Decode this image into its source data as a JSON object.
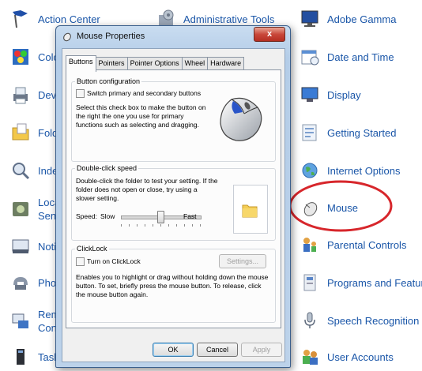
{
  "control_panel": {
    "items": [
      {
        "label": "Action Center",
        "icon": "flag-icon"
      },
      {
        "label": "Administrative Tools",
        "icon": "admin-tools-icon"
      },
      {
        "label": "Adobe Gamma",
        "icon": "monitor-icon"
      },
      {
        "label": "Colo",
        "icon": "color-icon"
      },
      {
        "label": "Date and Time",
        "icon": "calendar-icon"
      },
      {
        "label": "Devi",
        "icon": "printer-icon"
      },
      {
        "label": "Display",
        "icon": "display-icon"
      },
      {
        "label": "Fold",
        "icon": "folder-icon"
      },
      {
        "label": "Getting Started",
        "icon": "getting-started-icon"
      },
      {
        "label": "Inde",
        "icon": "indexing-icon"
      },
      {
        "label": "Internet Options",
        "icon": "globe-icon"
      },
      {
        "label": "Loca",
        "label2": "Sens",
        "icon": "sensor-icon"
      },
      {
        "label": "Mouse",
        "icon": "mouse-icon"
      },
      {
        "label": "Noti",
        "icon": "notification-icon"
      },
      {
        "label": "Parental Controls",
        "icon": "parental-controls-icon"
      },
      {
        "label": "Phon",
        "icon": "phone-icon"
      },
      {
        "label": "Programs and Features",
        "icon": "programs-icon"
      },
      {
        "label": "Rem",
        "label2": "Con",
        "icon": "remote-icon"
      },
      {
        "label": "Speech Recognition",
        "icon": "microphone-icon"
      },
      {
        "label": "Task",
        "icon": "taskbar-icon"
      },
      {
        "label": "User Accounts",
        "icon": "users-icon"
      }
    ],
    "highlight_color": "#d7262b"
  },
  "dialog": {
    "title": "Mouse Properties",
    "close_label": "x",
    "tabs": [
      "Buttons",
      "Pointers",
      "Pointer Options",
      "Wheel",
      "Hardware"
    ],
    "active_tab": "Buttons",
    "button_config": {
      "heading": "Button configuration",
      "checkbox_label": "Switch primary and secondary buttons",
      "description": "Select this check box to make the button on the right the one you use for primary functions such as selecting and dragging.",
      "checked": false
    },
    "double_click": {
      "heading": "Double-click speed",
      "description": "Double-click the folder to test your setting. If the folder does not open or close, try using a slower setting.",
      "speed_label": "Speed:",
      "slow_label": "Slow",
      "fast_label": "Fast",
      "speed_value": 0.5
    },
    "clicklock": {
      "heading": "ClickLock",
      "checkbox_label": "Turn on ClickLock",
      "settings_button": "Settings...",
      "description": "Enables you to highlight or drag without holding down the mouse button. To set, briefly press the mouse button. To release, click the mouse button again.",
      "checked": false
    },
    "buttons": {
      "ok": "OK",
      "cancel": "Cancel",
      "apply": "Apply"
    }
  }
}
